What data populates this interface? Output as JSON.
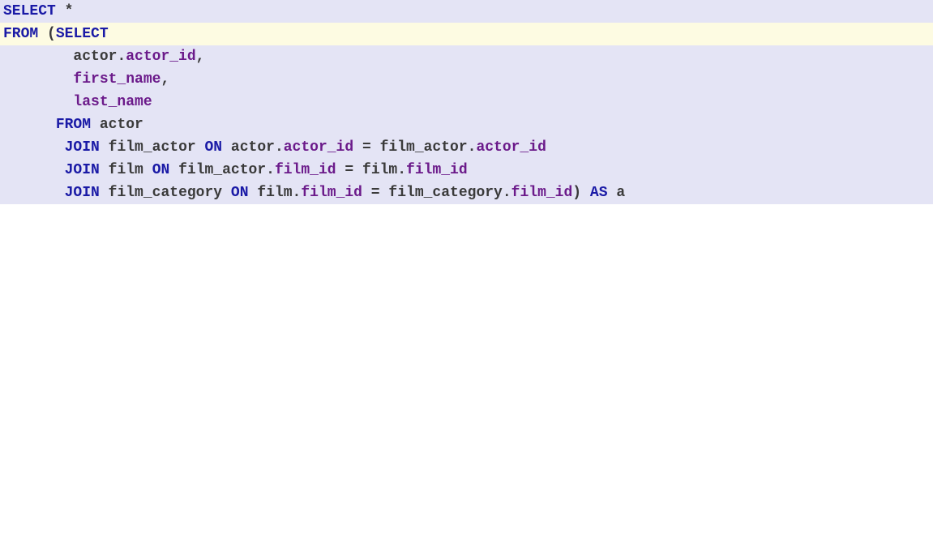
{
  "sql": {
    "kw_select": "SELECT",
    "kw_from": "FROM",
    "kw_join": "JOIN",
    "kw_on": "ON",
    "kw_as": "AS",
    "star": "*",
    "open_paren": "(",
    "close_paren": ")",
    "dot": ".",
    "comma": ",",
    "eq": "=",
    "tbl_actor": "actor",
    "tbl_film_actor": "film_actor",
    "tbl_film": "film",
    "tbl_film_category": "film_category",
    "col_actor_id": "actor_id",
    "col_first_name": "first_name",
    "col_last_name": "last_name",
    "col_film_id": "film_id",
    "alias_a": "a"
  }
}
